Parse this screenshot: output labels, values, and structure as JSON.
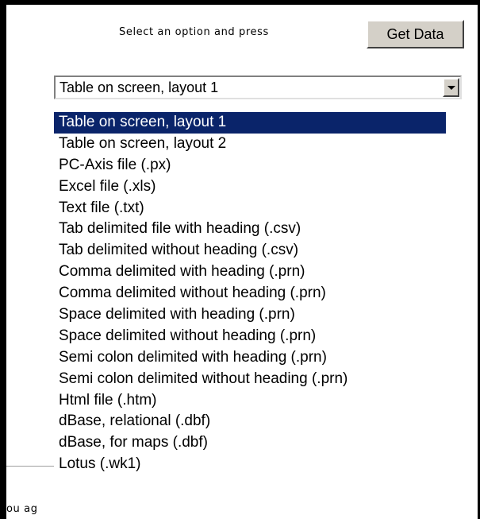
{
  "header": {
    "prompt": "Select an option and press",
    "get_data_label": "Get Data"
  },
  "select": {
    "value": "Table on screen, layout 1",
    "options": [
      "Table on screen, layout 1",
      "Table on screen, layout 2",
      "PC-Axis file (.px)",
      "Excel file (.xls)",
      "Text file (.txt)",
      "Tab delimited file with heading (.csv)",
      "Tab delimited without heading (.csv)",
      "Comma delimited with heading (.prn)",
      "Comma delimited without heading (.prn)",
      "Space delimited with heading (.prn)",
      "Space delimited without heading (.prn)",
      "Semi colon delimited with heading (.prn)",
      "Semi colon delimited without heading (.prn)",
      "Html file (.htm)",
      "dBase, relational (.dbf)",
      "dBase, for maps (.dbf)",
      "Lotus (.wk1)"
    ],
    "selected_index": 0
  },
  "background": {
    "partial_text": "ou ag"
  },
  "colors": {
    "selection_bg": "#0a246a",
    "selection_fg": "#ffffff",
    "button_face": "#d4d0c8"
  },
  "icons": {
    "dropdown": "chevron-down-icon"
  }
}
